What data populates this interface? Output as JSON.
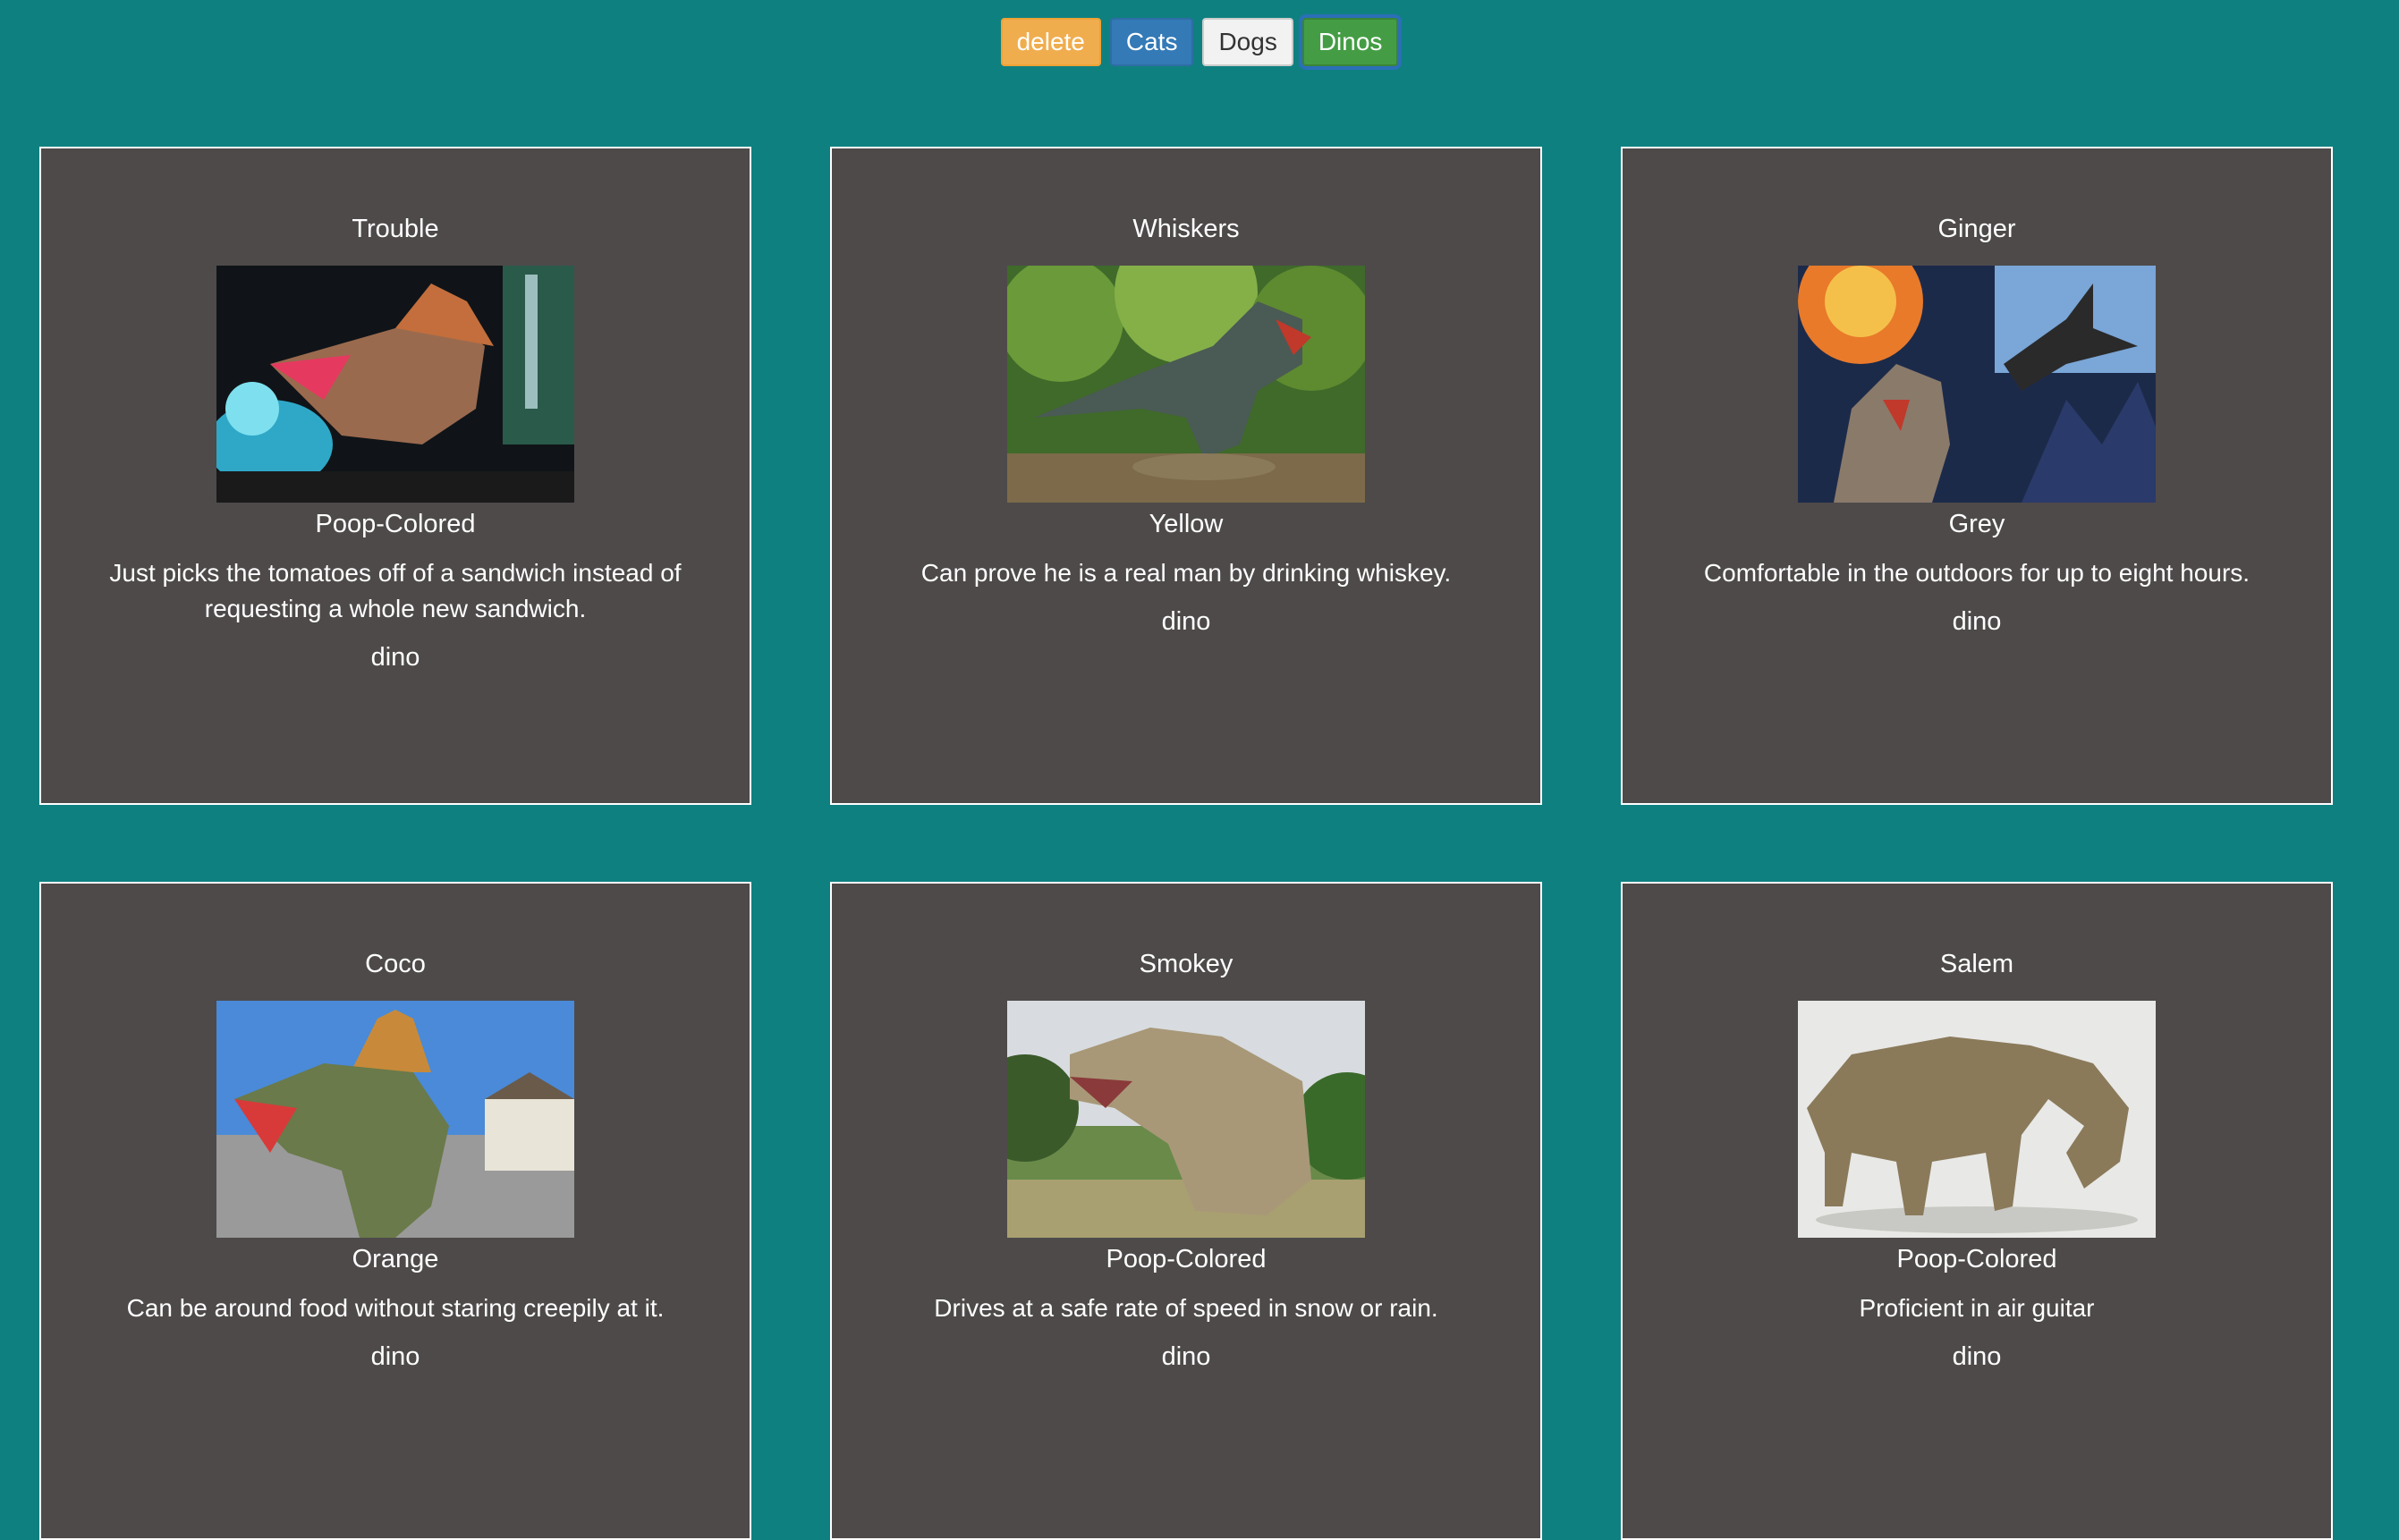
{
  "toolbar": {
    "delete_label": "delete",
    "cats_label": "Cats",
    "dogs_label": "Dogs",
    "dinos_label": "Dinos"
  },
  "cards": [
    {
      "name": "Trouble",
      "color": "Poop-Colored",
      "description": "Just picks the tomatoes off of a sandwich instead of requesting a whole new sandwich.",
      "type": "dino"
    },
    {
      "name": "Whiskers",
      "color": "Yellow",
      "description": "Can prove he is a real man by drinking whiskey.",
      "type": "dino"
    },
    {
      "name": "Ginger",
      "color": "Grey",
      "description": "Comfortable in the outdoors for up to eight hours.",
      "type": "dino"
    },
    {
      "name": "Coco",
      "color": "Orange",
      "description": "Can be around food without staring creepily at it.",
      "type": "dino"
    },
    {
      "name": "Smokey",
      "color": "Poop-Colored",
      "description": "Drives at a safe rate of speed in snow or rain.",
      "type": "dino"
    },
    {
      "name": "Salem",
      "color": "Poop-Colored",
      "description": "Proficient in air guitar",
      "type": "dino"
    }
  ]
}
